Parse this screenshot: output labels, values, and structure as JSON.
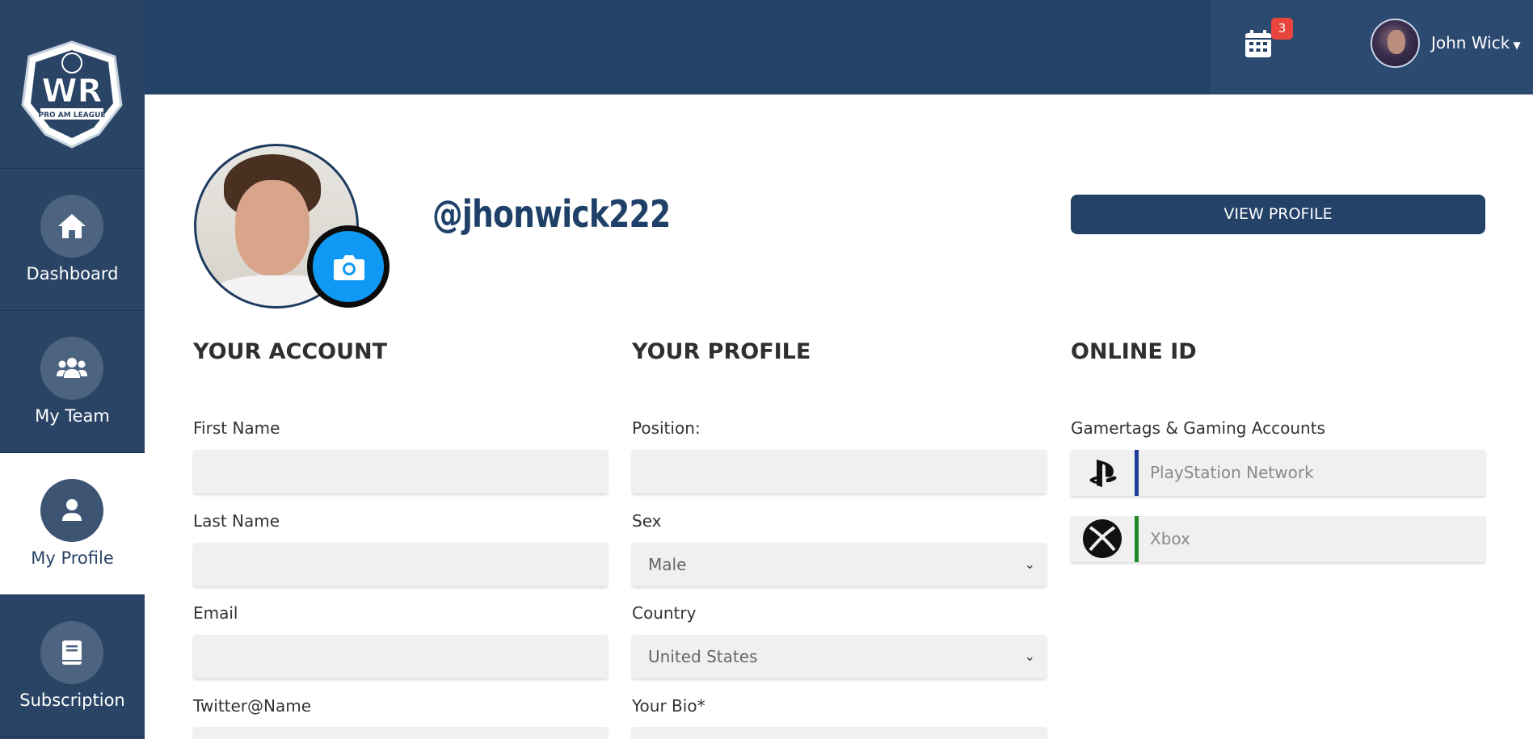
{
  "sidebar": {
    "logo_text": "WR",
    "logo_subtext": "PRO AM LEAGUE",
    "items": [
      {
        "label": "Dashboard",
        "icon": "home-icon"
      },
      {
        "label": "My Team",
        "icon": "team-icon"
      },
      {
        "label": "My Profile",
        "icon": "user-icon"
      },
      {
        "label": "Subscription",
        "icon": "book-icon"
      }
    ],
    "active": "My Profile"
  },
  "header": {
    "notification_count": "3",
    "user_name": "John Wick"
  },
  "profile": {
    "handle": "@jhonwick222",
    "view_profile_label": "VIEW PROFILE"
  },
  "account": {
    "title": "YOUR ACCOUNT",
    "first_name_label": "First Name",
    "first_name_value": "",
    "last_name_label": "Last Name",
    "last_name_value": "",
    "email_label": "Email",
    "email_value": "",
    "twitter_label": "Twitter@Name"
  },
  "your_profile": {
    "title": "YOUR PROFILE",
    "position_label": "Position:",
    "position_value": "",
    "sex_label": "Sex",
    "sex_value": "Male",
    "country_label": "Country",
    "country_value": "United States",
    "bio_label": "Your Bio*"
  },
  "online_id": {
    "title": "ONLINE ID",
    "gaming_label": "Gamertags & Gaming Accounts",
    "psn_placeholder": "PlayStation Network",
    "xbox_placeholder": "Xbox"
  },
  "colors": {
    "sidebar": "#2a4466",
    "topbar": "#244268",
    "accent_blue": "#0f99f5",
    "badge_red": "#e8453c",
    "psn_divider": "#1d3f9a",
    "xbox_divider": "#1f8a2a"
  }
}
